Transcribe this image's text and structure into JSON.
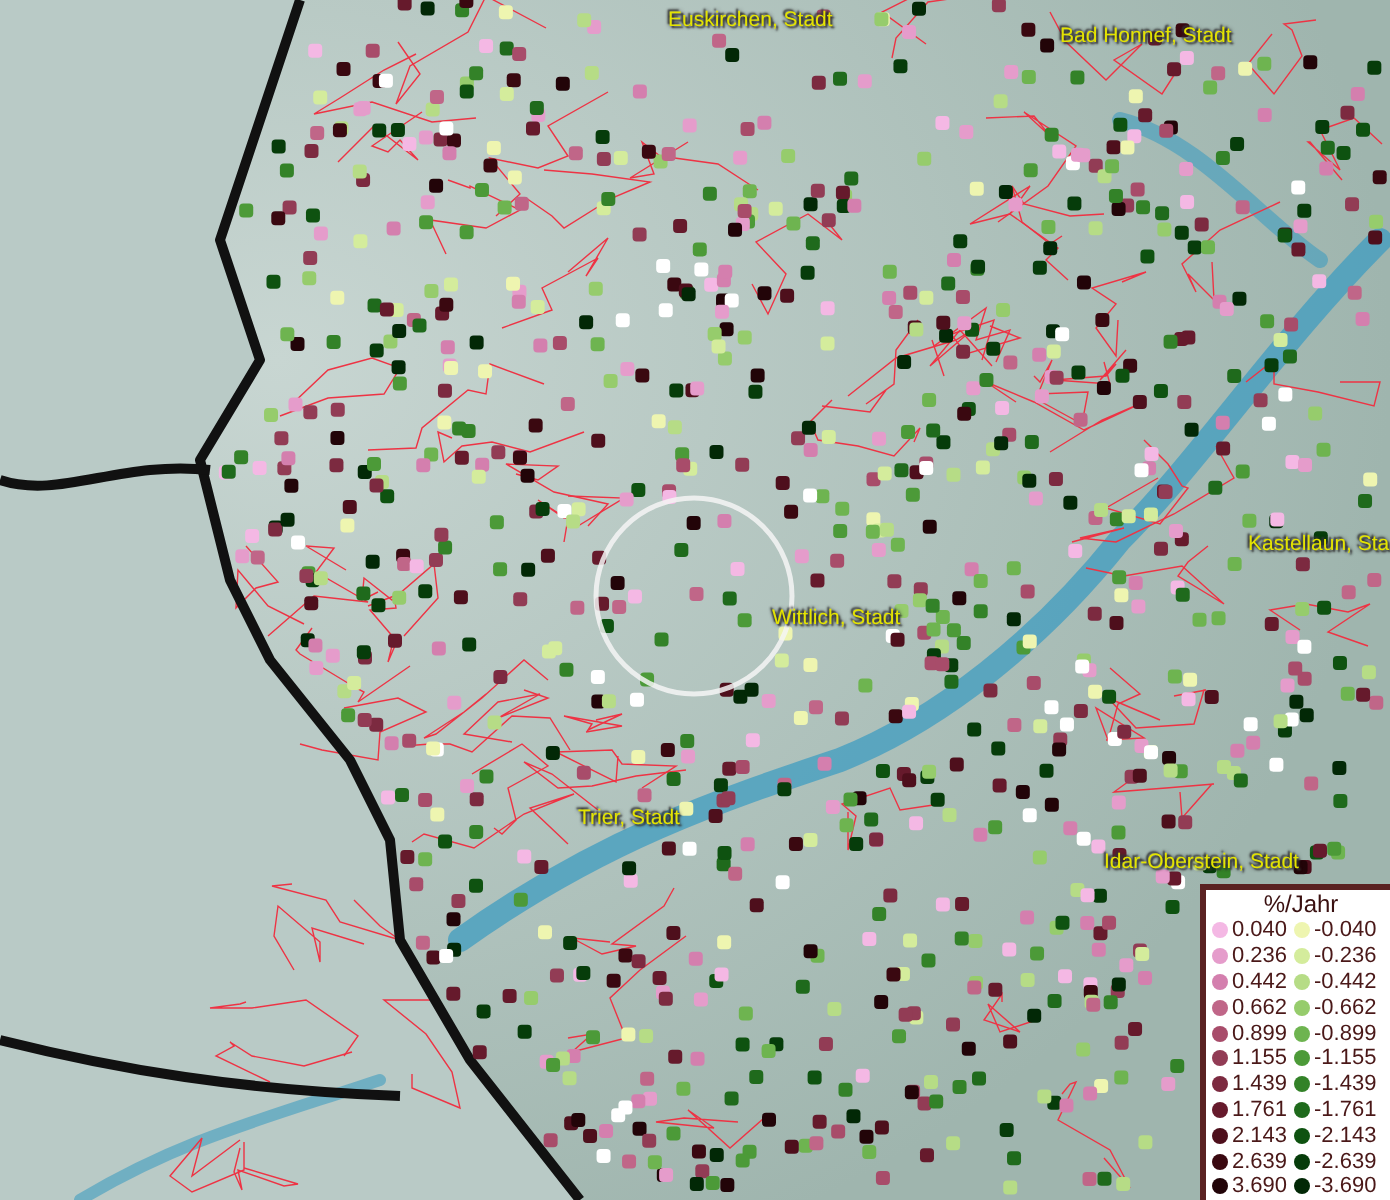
{
  "map": {
    "place_labels": [
      {
        "text": "Euskirchen, Stadt"
      },
      {
        "text": "Bad Honnef, Stadt"
      },
      {
        "text": "Kastellaun, Sta"
      },
      {
        "text": "Wittlich, Stadt"
      },
      {
        "text": "Trier, Stadt"
      },
      {
        "text": "Idar-Oberstein, Stadt"
      }
    ]
  },
  "legend": {
    "title": "%/Jahr",
    "items": [
      {
        "label": "0.040",
        "color": "#f4b8e4"
      },
      {
        "label": "-0.040",
        "color": "#eef5b0"
      },
      {
        "label": "0.236",
        "color": "#e59ccb"
      },
      {
        "label": "-0.236",
        "color": "#d4ec9c"
      },
      {
        "label": "0.442",
        "color": "#d47fae"
      },
      {
        "label": "-0.442",
        "color": "#b6dc86"
      },
      {
        "label": "0.662",
        "color": "#c06688"
      },
      {
        "label": "-0.662",
        "color": "#96cc6c"
      },
      {
        "label": "0.899",
        "color": "#a84c6a"
      },
      {
        "label": "-0.899",
        "color": "#6eb450"
      },
      {
        "label": "1.155",
        "color": "#923c55"
      },
      {
        "label": "-1.155",
        "color": "#4c9a38"
      },
      {
        "label": "1.439",
        "color": "#7c2a40"
      },
      {
        "label": "-1.439",
        "color": "#338228"
      },
      {
        "label": "1.761",
        "color": "#661a2c"
      },
      {
        "label": "-1.761",
        "color": "#1f6a1c"
      },
      {
        "label": "2.143",
        "color": "#4e0f1c"
      },
      {
        "label": "-2.143",
        "color": "#0e5210"
      },
      {
        "label": "2.639",
        "color": "#3a0810"
      },
      {
        "label": "-2.639",
        "color": "#063c0a"
      },
      {
        "label": "3.690",
        "color": "#220408"
      },
      {
        "label": "-3.690",
        "color": "#022806"
      }
    ]
  }
}
